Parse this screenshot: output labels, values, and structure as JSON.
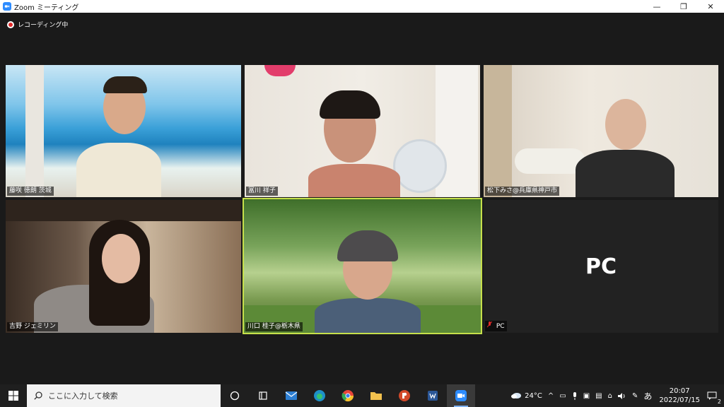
{
  "window": {
    "title": "Zoom ミーティング",
    "minimize": "—",
    "restore": "❐",
    "close": "✕"
  },
  "recording": {
    "label": "レコーディング中"
  },
  "participants": [
    {
      "name": "藤咲 徳朗 茨城"
    },
    {
      "name": "冨川 祥子"
    },
    {
      "name": "松下みさ@兵庫県神戸市"
    },
    {
      "name": "吉野 ジェミリン"
    },
    {
      "name": "川口 桂子@栃木県",
      "active_speaker": true
    },
    {
      "name": "PC",
      "avatar_text": "PC",
      "mic_muted": true
    }
  ],
  "taskbar": {
    "search_placeholder": "ここに入力して検索",
    "weather": "24°C",
    "ime": "あ",
    "time": "20:07",
    "date": "2022/07/15",
    "notification_count": "2"
  },
  "colors": {
    "active_speaker_border": "#c6e04b",
    "zoom_blue": "#2d8cff",
    "recording_red": "#e02828"
  }
}
